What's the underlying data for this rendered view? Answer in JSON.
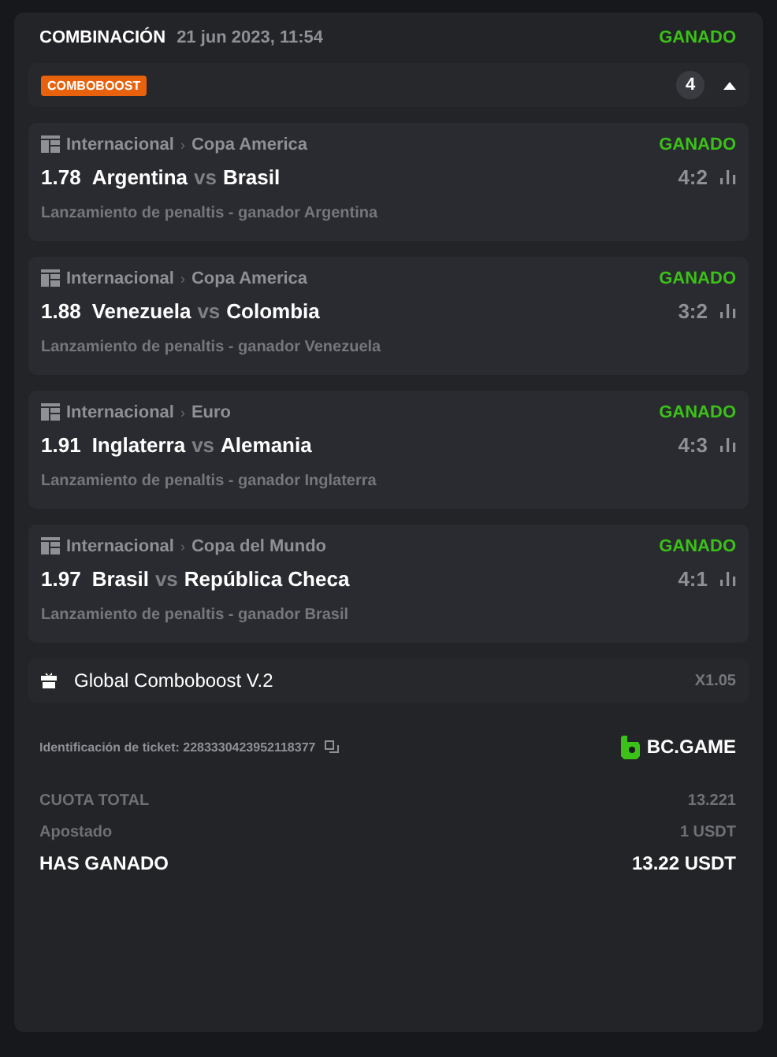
{
  "header": {
    "title": "COMBINACIÓN",
    "date": "21 jun 2023, 11:54",
    "status": "GANADO"
  },
  "boost": {
    "badge": "COMBOBOOST",
    "count": "4",
    "expanded": true
  },
  "matches": [
    {
      "league": "Internacional",
      "separator": "›",
      "competition": "Copa America",
      "status": "GANADO",
      "odds": "1.78",
      "home": "Argentina",
      "vs": "vs",
      "away": "Brasil",
      "score": "4:2",
      "selection": "Lanzamiento de penaltis - ganador Argentina"
    },
    {
      "league": "Internacional",
      "separator": "›",
      "competition": "Copa America",
      "status": "GANADO",
      "odds": "1.88",
      "home": "Venezuela",
      "vs": "vs",
      "away": "Colombia",
      "score": "3:2",
      "selection": "Lanzamiento de penaltis - ganador Venezuela"
    },
    {
      "league": "Internacional",
      "separator": "›",
      "competition": "Euro",
      "status": "GANADO",
      "odds": "1.91",
      "home": "Inglaterra",
      "vs": "vs",
      "away": "Alemania",
      "score": "4:3",
      "selection": "Lanzamiento de penaltis - ganador Inglaterra"
    },
    {
      "league": "Internacional",
      "separator": "›",
      "competition": "Copa del Mundo",
      "status": "GANADO",
      "odds": "1.97",
      "home": "Brasil",
      "vs": "vs",
      "away": "República Checa",
      "score": "4:1",
      "selection": "Lanzamiento de penaltis - ganador Brasil"
    }
  ],
  "bonus": {
    "label": "Global Comboboost V.2",
    "multiplier": "X1.05"
  },
  "ticket": {
    "id_text": "Identificación de ticket: 2283330423952118377",
    "brand": "BC.GAME"
  },
  "totals": [
    {
      "kind": "muted",
      "label": "CUOTA TOTAL",
      "value": "13.221"
    },
    {
      "kind": "muted",
      "label": "Apostado",
      "value": "1 USDT"
    },
    {
      "kind": "strong",
      "label": "HAS GANADO",
      "value": "13.22 USDT"
    }
  ]
}
